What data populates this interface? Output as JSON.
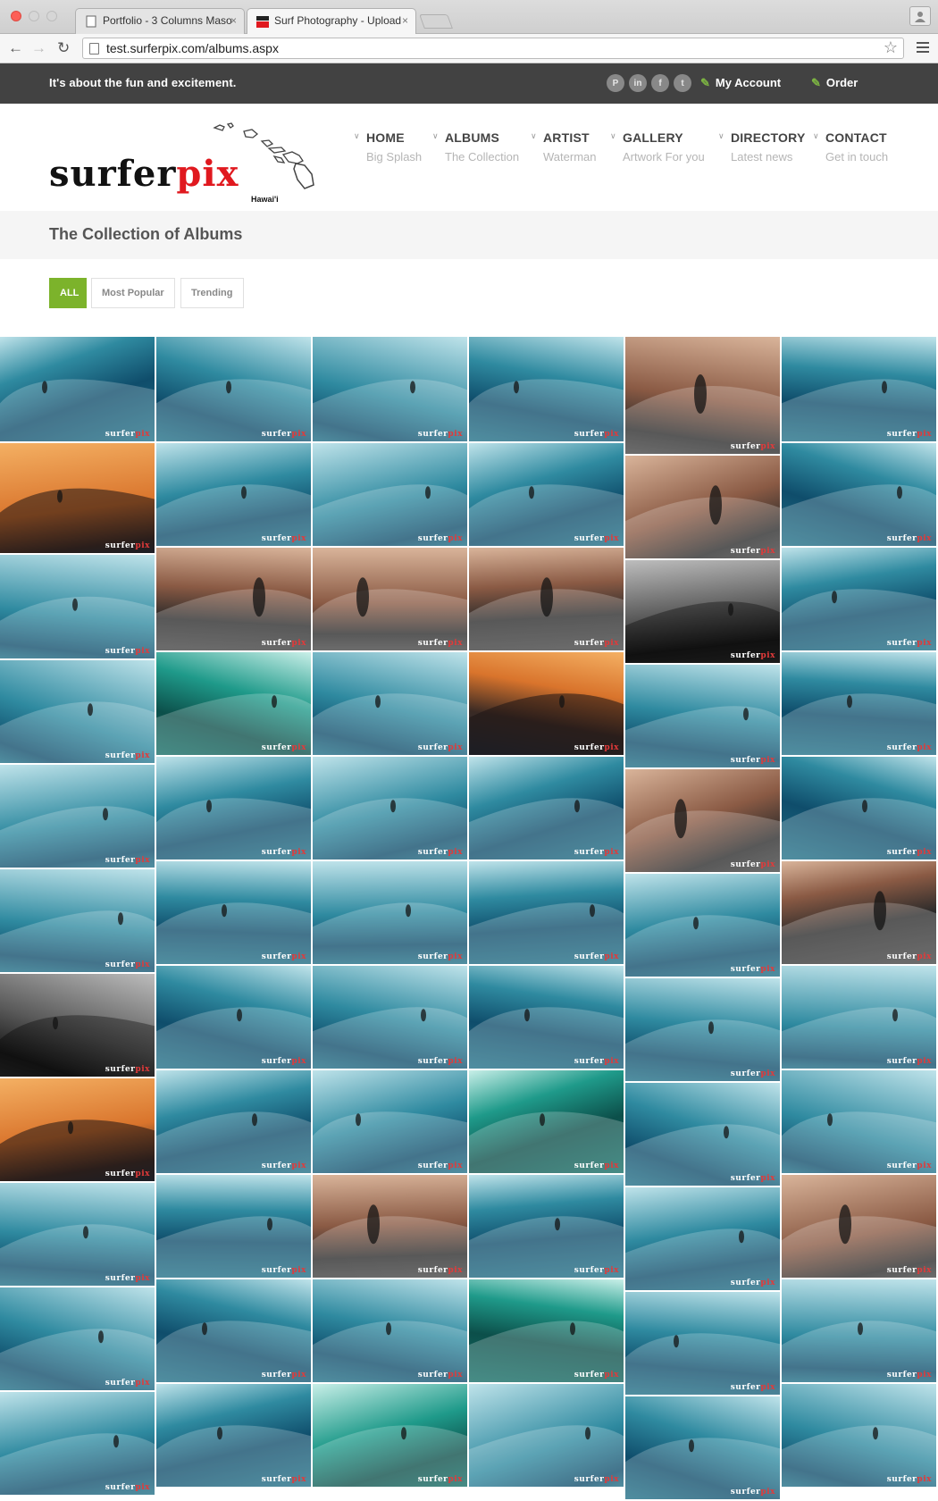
{
  "browser": {
    "tabs": [
      {
        "title": "Portfolio - 3 Columns Maso",
        "close": "×"
      },
      {
        "title": "Surf Photography - Upload",
        "close": "×",
        "active": true
      }
    ],
    "url": "test.surferpix.com/albums.aspx"
  },
  "topbar": {
    "tagline": "It's about the fun and excitement.",
    "socials": [
      {
        "icon": "pinterest-icon",
        "glyph": "P"
      },
      {
        "icon": "linkedin-icon",
        "glyph": "in"
      },
      {
        "icon": "facebook-icon",
        "glyph": "f"
      },
      {
        "icon": "twitter-icon",
        "glyph": "t"
      }
    ],
    "my_account": "My Account",
    "order": "Order"
  },
  "logo": {
    "text_a": "surfer",
    "text_b": "pix",
    "subtitle": "Hawai'i"
  },
  "nav": [
    {
      "label": "HOME",
      "sub": "Big Splash"
    },
    {
      "label": "ALBUMS",
      "sub": "The Collection"
    },
    {
      "label": "ARTIST",
      "sub": "Waterman"
    },
    {
      "label": "GALLERY",
      "sub": "Artwork For you"
    },
    {
      "label": "DIRECTORY",
      "sub": "Latest news"
    },
    {
      "label": "CONTACT",
      "sub": "Get in touch"
    }
  ],
  "page": {
    "title": "The Collection of Albums"
  },
  "filters": [
    {
      "label": "ALL",
      "active": true
    },
    {
      "label": "Most Popular",
      "active": false
    },
    {
      "label": "Trending",
      "active": false
    }
  ],
  "gallery": {
    "watermark_a": "surfer",
    "watermark_b": "pix",
    "columns": [
      [
        "wave",
        "sunset",
        "wave",
        "wave",
        "wave",
        "wave",
        "dark",
        "sunset",
        "wave",
        "wave",
        "wave"
      ],
      [
        "wave",
        "wave",
        "people",
        "green",
        "wave",
        "wave",
        "wave",
        "wave",
        "wave",
        "wave",
        "wave"
      ],
      [
        "wave",
        "wave",
        "people",
        "wave",
        "wave",
        "wave",
        "wave",
        "wave",
        "people",
        "wave",
        "green"
      ],
      [
        "wave",
        "wave",
        "people",
        "sunset",
        "wave",
        "wave",
        "wave",
        "green",
        "wave",
        "green",
        "wave"
      ],
      [
        "people",
        "people",
        "dark",
        "wave",
        "people",
        "wave",
        "wave",
        "wave",
        "wave",
        "wave",
        "wave"
      ],
      [
        "wave",
        "wave",
        "wave",
        "wave",
        "wave",
        "people",
        "wave",
        "wave",
        "people",
        "wave",
        "wave"
      ]
    ]
  }
}
